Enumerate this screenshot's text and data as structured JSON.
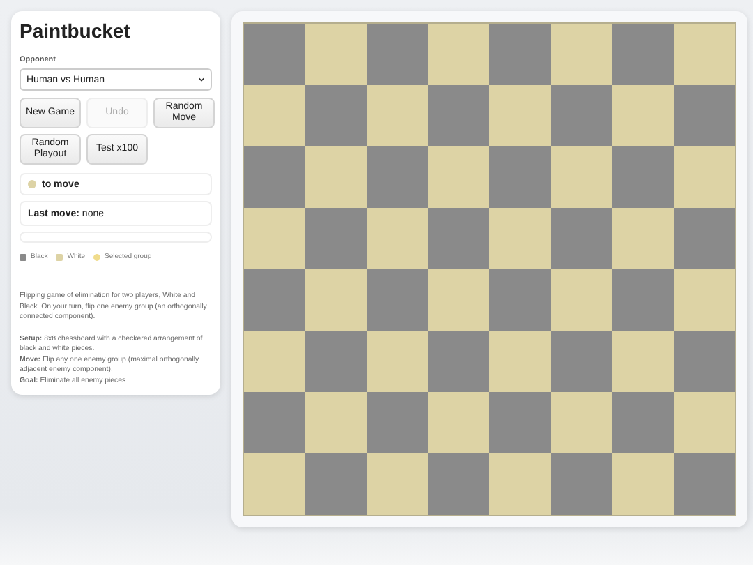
{
  "title": "Paintbucket",
  "opponent": {
    "label": "Opponent",
    "value": "Human vs Human"
  },
  "buttons": [
    {
      "label": "New Game",
      "disabled": false
    },
    {
      "label": "Undo",
      "disabled": true
    },
    {
      "label": "Random Move",
      "disabled": false
    },
    {
      "label": "Random Playout",
      "disabled": false
    },
    {
      "label": "Test x100",
      "disabled": false
    }
  ],
  "turn": {
    "color": "#ddd3a5",
    "text": "to move"
  },
  "last_move": {
    "label": "Last move:",
    "value": "none"
  },
  "legend": [
    {
      "label": "Black",
      "color": "#8a8a8a"
    },
    {
      "label": "White",
      "color": "#ddd3a5"
    },
    {
      "label": "Selected group",
      "color": "#f0dc8c"
    }
  ],
  "description": [
    "Flipping game of elimination for two players, White and Black. On your turn, flip one enemy group (an orthogonally connected component)."
  ],
  "rules": [
    {
      "term": "Setup:",
      "text": "8x8 chessboard with a checkered arrangement of black and white pieces."
    },
    {
      "term": "Move:",
      "text": "Flip any one enemy group (maximal orthogonally adjacent enemy component)."
    },
    {
      "term": "Goal:",
      "text": "Eliminate all enemy pieces."
    }
  ],
  "board": [
    [
      {
        "color": "#8a8a8a"
      },
      {
        "color": "#ddd3a5"
      },
      {
        "color": "#8a8a8a"
      },
      {
        "color": "#ddd3a5"
      },
      {
        "color": "#8a8a8a"
      },
      {
        "color": "#ddd3a5"
      },
      {
        "color": "#8a8a8a"
      },
      {
        "color": "#ddd3a5"
      }
    ],
    [
      {
        "color": "#ddd3a5"
      },
      {
        "color": "#8a8a8a"
      },
      {
        "color": "#ddd3a5"
      },
      {
        "color": "#8a8a8a"
      },
      {
        "color": "#ddd3a5"
      },
      {
        "color": "#8a8a8a"
      },
      {
        "color": "#ddd3a5"
      },
      {
        "color": "#8a8a8a"
      }
    ],
    [
      {
        "color": "#8a8a8a"
      },
      {
        "color": "#ddd3a5"
      },
      {
        "color": "#8a8a8a"
      },
      {
        "color": "#ddd3a5"
      },
      {
        "color": "#8a8a8a"
      },
      {
        "color": "#ddd3a5"
      },
      {
        "color": "#8a8a8a"
      },
      {
        "color": "#ddd3a5"
      }
    ],
    [
      {
        "color": "#ddd3a5"
      },
      {
        "color": "#8a8a8a"
      },
      {
        "color": "#ddd3a5"
      },
      {
        "color": "#8a8a8a"
      },
      {
        "color": "#ddd3a5"
      },
      {
        "color": "#8a8a8a"
      },
      {
        "color": "#ddd3a5"
      },
      {
        "color": "#8a8a8a"
      }
    ],
    [
      {
        "color": "#8a8a8a"
      },
      {
        "color": "#ddd3a5"
      },
      {
        "color": "#8a8a8a"
      },
      {
        "color": "#ddd3a5"
      },
      {
        "color": "#8a8a8a"
      },
      {
        "color": "#ddd3a5"
      },
      {
        "color": "#8a8a8a"
      },
      {
        "color": "#ddd3a5"
      }
    ],
    [
      {
        "color": "#ddd3a5"
      },
      {
        "color": "#8a8a8a"
      },
      {
        "color": "#ddd3a5"
      },
      {
        "color": "#8a8a8a"
      },
      {
        "color": "#ddd3a5"
      },
      {
        "color": "#8a8a8a"
      },
      {
        "color": "#ddd3a5"
      },
      {
        "color": "#8a8a8a"
      }
    ],
    [
      {
        "color": "#8a8a8a"
      },
      {
        "color": "#ddd3a5"
      },
      {
        "color": "#8a8a8a"
      },
      {
        "color": "#ddd3a5"
      },
      {
        "color": "#8a8a8a"
      },
      {
        "color": "#ddd3a5"
      },
      {
        "color": "#8a8a8a"
      },
      {
        "color": "#ddd3a5"
      }
    ],
    [
      {
        "color": "#ddd3a5"
      },
      {
        "color": "#8a8a8a"
      },
      {
        "color": "#ddd3a5"
      },
      {
        "color": "#8a8a8a"
      },
      {
        "color": "#ddd3a5"
      },
      {
        "color": "#8a8a8a"
      },
      {
        "color": "#ddd3a5"
      },
      {
        "color": "#8a8a8a"
      }
    ]
  ]
}
